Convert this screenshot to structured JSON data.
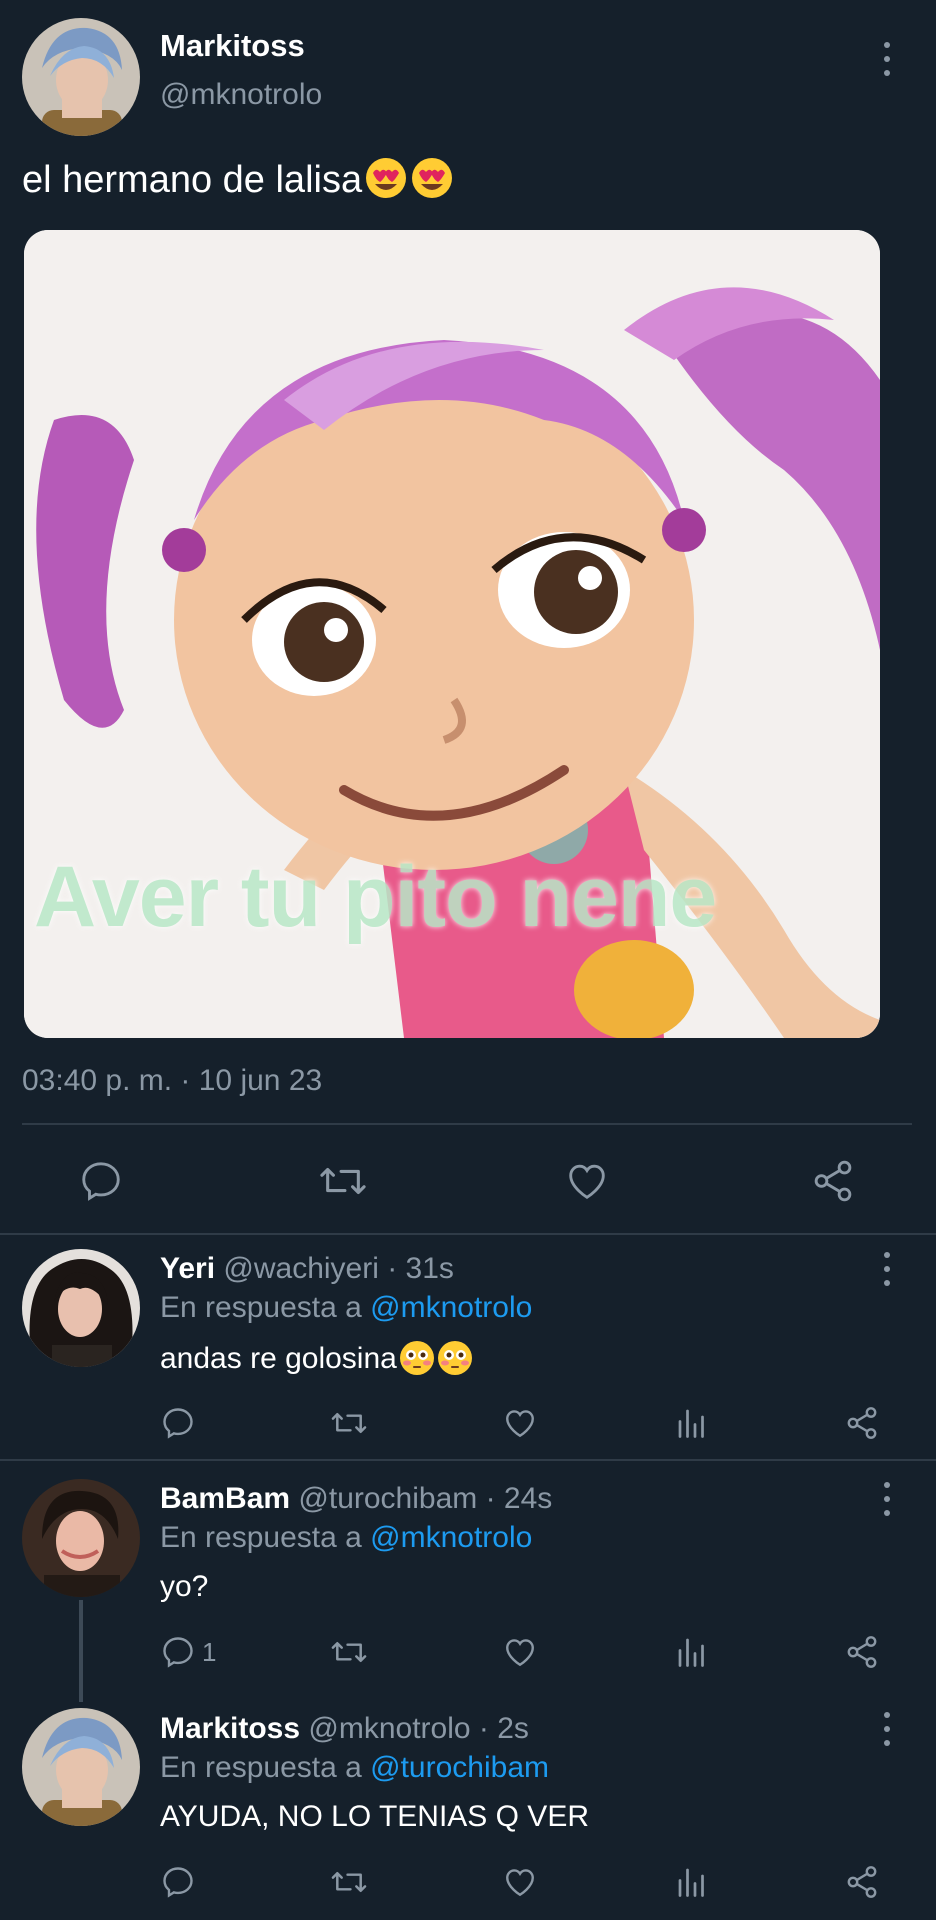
{
  "main_tweet": {
    "display_name": "Markitoss",
    "handle": "@mknotrolo",
    "text": "el hermano de lalisa",
    "text_emojis": [
      "heart-eyes-emoji",
      "heart-eyes-emoji"
    ],
    "image_caption": "Aver tu pito nene",
    "timestamp": "03:40 p. m. · 10 jun 23"
  },
  "replies": [
    {
      "display_name": "Yeri",
      "handle_time": "@wachiyeri · 31s",
      "reply_prefix": "En respuesta a",
      "reply_to": "@mknotrolo",
      "text": "andas re golosina",
      "text_emojis": [
        "flushed-emoji",
        "flushed-emoji"
      ],
      "reply_count": ""
    },
    {
      "display_name": "BamBam",
      "handle_time": "@turochibam · 24s",
      "reply_prefix": "En respuesta a",
      "reply_to": "@mknotrolo",
      "text": "yo?",
      "reply_count": "1"
    },
    {
      "display_name": "Markitoss",
      "handle_time": "@mknotrolo · 2s",
      "reply_prefix": "En respuesta a",
      "reply_to": "@turochibam",
      "text": "AYUDA, NO LO TENIAS Q VER",
      "reply_count": ""
    }
  ],
  "colors": {
    "background": "#15202b",
    "muted": "#8b98a5",
    "link": "#1d9bf0",
    "divider": "#2f3b47"
  }
}
